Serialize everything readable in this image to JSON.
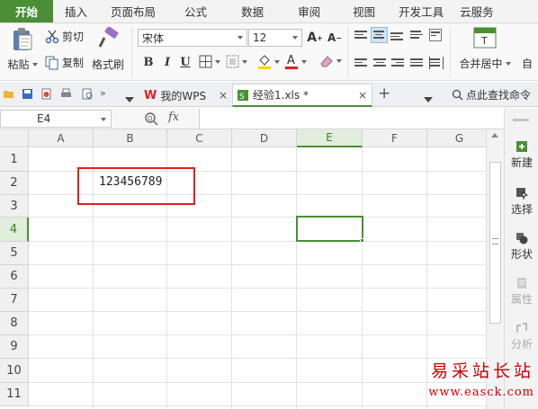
{
  "ribbon_tabs": [
    "开始",
    "插入",
    "页面布局",
    "公式",
    "数据",
    "审阅",
    "视图",
    "开发工具",
    "云服务"
  ],
  "active_tab": "开始",
  "clipboard": {
    "paste": "粘贴",
    "cut": "剪切",
    "copy": "复制",
    "format_painter": "格式刷"
  },
  "font": {
    "name": "宋体",
    "size": "12",
    "bold": "B",
    "italic": "I",
    "underline": "U"
  },
  "merge": {
    "label": "合并居中",
    "auto": "自"
  },
  "doc_tabs": [
    {
      "label": "我的WPS",
      "close": "×"
    },
    {
      "label": "经验1.xls *",
      "close": "×"
    }
  ],
  "new_tab": "+",
  "search_command": "点此查找命令",
  "name_box": "E4",
  "fx": "fx",
  "columns": [
    "A",
    "B",
    "C",
    "D",
    "E",
    "F",
    "G"
  ],
  "rows": [
    "1",
    "2",
    "3",
    "4",
    "5",
    "6",
    "7",
    "8",
    "9",
    "10",
    "11"
  ],
  "selected_cell": "E4",
  "cells": {
    "B2": "123456789"
  },
  "side_panel": [
    "新建",
    "选择",
    "形状",
    "属性",
    "分析"
  ],
  "watermark": {
    "line1": "易采站长站",
    "line2": "www.easck.com"
  },
  "colors": {
    "accent": "#4a8f36",
    "highlight_box": "#e02020",
    "font_color": "#e02020",
    "fill_color": "#ffd400"
  }
}
